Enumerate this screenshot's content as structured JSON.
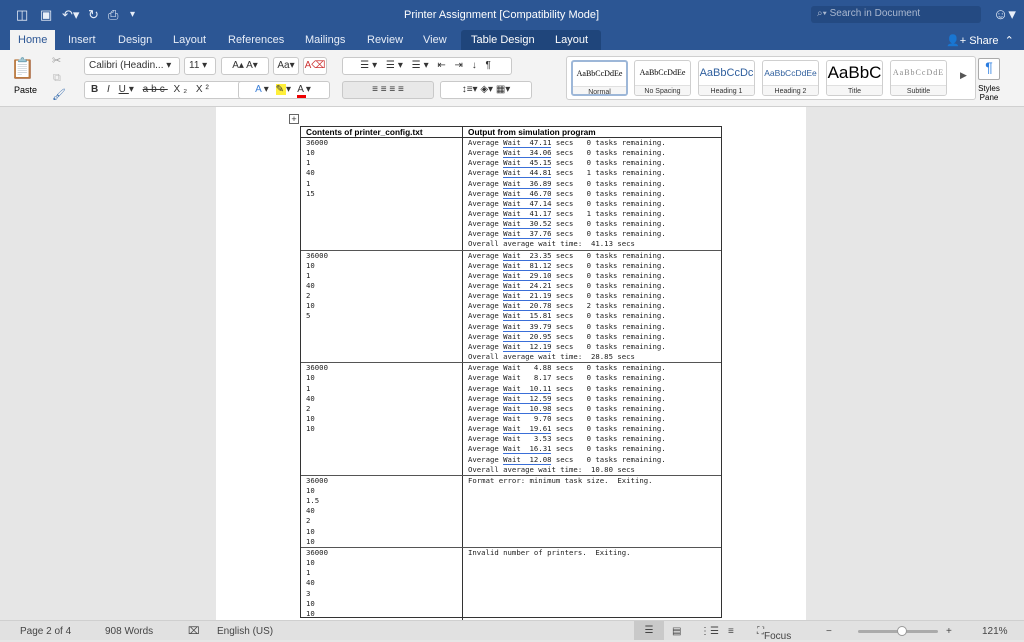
{
  "window": {
    "title": "Printer Assignment  [Compatibility Mode]",
    "search_placeholder": "Search in Document"
  },
  "tabs": [
    "Home",
    "Insert",
    "Design",
    "Layout",
    "References",
    "Mailings",
    "Review",
    "View",
    "Table Design",
    "Layout"
  ],
  "share_label": "Share",
  "ribbon": {
    "paste": "Paste",
    "font_name": "Calibri (Headin...",
    "font_size": "11",
    "styles": [
      {
        "preview": "AaBbCcDdEe",
        "label": "Normal"
      },
      {
        "preview": "AaBbCcDdEe",
        "label": "No Spacing"
      },
      {
        "preview": "AaBbCcDc",
        "label": "Heading 1"
      },
      {
        "preview": "AaBbCcDdEe",
        "label": "Heading 2"
      },
      {
        "preview": "AaBbC",
        "label": "Title"
      },
      {
        "preview": "AaBbCcDdE",
        "label": "Subtitle"
      }
    ],
    "styles_pane": "Styles Pane"
  },
  "table": {
    "headers": [
      "Contents of printer_config.txt",
      "Output from simulation program"
    ],
    "rows": [
      {
        "config": [
          "36000",
          "10",
          "1",
          "40",
          "1",
          "15"
        ],
        "output": [
          {
            "t": "Average Wait  47.11 secs   0 tasks remaining.",
            "u": true
          },
          {
            "t": "Average Wait  34.06 secs   0 tasks remaining.",
            "u": true
          },
          {
            "t": "Average Wait  45.15 secs   0 tasks remaining.",
            "u": true
          },
          {
            "t": "Average Wait  44.81 secs   1 tasks remaining.",
            "u": true
          },
          {
            "t": "Average Wait  36.89 secs   0 tasks remaining.",
            "u": true
          },
          {
            "t": "Average Wait  46.70 secs   0 tasks remaining.",
            "u": true
          },
          {
            "t": "Average Wait  47.14 secs   0 tasks remaining.",
            "u": true
          },
          {
            "t": "Average Wait  41.17 secs   1 tasks remaining.",
            "u": true
          },
          {
            "t": "Average Wait  30.52 secs   0 tasks remaining.",
            "u": true
          },
          {
            "t": "Average Wait  37.76 secs   0 tasks remaining.",
            "u": true
          },
          {
            "t": "Overall average wait time:  41.13 secs",
            "u": false
          }
        ]
      },
      {
        "config": [
          "36000",
          "10",
          "1",
          "40",
          "2",
          "10",
          "5"
        ],
        "output": [
          {
            "t": "Average Wait  23.35 secs   0 tasks remaining.",
            "u": true
          },
          {
            "t": "Average Wait  81.12 secs   0 tasks remaining.",
            "u": true
          },
          {
            "t": "Average Wait  29.10 secs   0 tasks remaining.",
            "u": true
          },
          {
            "t": "Average Wait  24.21 secs   0 tasks remaining.",
            "u": true
          },
          {
            "t": "Average Wait  21.19 secs   0 tasks remaining.",
            "u": true
          },
          {
            "t": "Average Wait  20.78 secs   2 tasks remaining.",
            "u": true
          },
          {
            "t": "Average Wait  15.81 secs   0 tasks remaining.",
            "u": true
          },
          {
            "t": "Average Wait  39.79 secs   0 tasks remaining.",
            "u": true
          },
          {
            "t": "Average Wait  20.95 secs   0 tasks remaining.",
            "u": true
          },
          {
            "t": "Average Wait  12.19 secs   0 tasks remaining.",
            "u": true
          },
          {
            "t": "Overall average wait time:  28.85 secs",
            "u": false
          }
        ]
      },
      {
        "config": [
          "36000",
          "10",
          "1",
          "40",
          "2",
          "10",
          "10"
        ],
        "output": [
          {
            "t": "Average Wait   4.88 secs   0 tasks remaining.",
            "u": false
          },
          {
            "t": "Average Wait   8.17 secs   0 tasks remaining.",
            "u": false
          },
          {
            "t": "Average Wait  10.11 secs   0 tasks remaining.",
            "u": true
          },
          {
            "t": "Average Wait  12.59 secs   0 tasks remaining.",
            "u": true
          },
          {
            "t": "Average Wait  10.98 secs   0 tasks remaining.",
            "u": true
          },
          {
            "t": "Average Wait   9.70 secs   0 tasks remaining.",
            "u": false
          },
          {
            "t": "Average Wait  19.61 secs   0 tasks remaining.",
            "u": true
          },
          {
            "t": "Average Wait   3.53 secs   0 tasks remaining.",
            "u": false
          },
          {
            "t": "Average Wait  16.31 secs   0 tasks remaining.",
            "u": true
          },
          {
            "t": "Average Wait  12.08 secs   0 tasks remaining.",
            "u": true
          },
          {
            "t": "Overall average wait time:  10.80 secs",
            "u": false
          }
        ]
      },
      {
        "config": [
          "36000",
          "10",
          "1.5",
          "40",
          "2",
          "10",
          "10"
        ],
        "output": [
          {
            "t": "Format error: minimum task size.  Exiting.",
            "u": false
          }
        ]
      },
      {
        "config": [
          "36000",
          "10",
          "1",
          "40",
          "3",
          "10",
          "10"
        ],
        "output": [
          {
            "t": "Invalid number of printers.  Exiting.",
            "u": false
          }
        ]
      }
    ]
  },
  "status": {
    "page": "Page 2 of 4",
    "words": "908 Words",
    "language": "English (US)",
    "focus": "Focus",
    "zoom": "121%",
    "zoom_level": 0.55
  }
}
